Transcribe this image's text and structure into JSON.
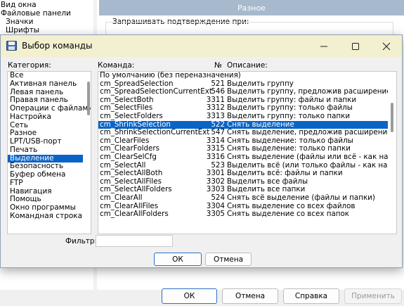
{
  "background": {
    "tree_items": [
      "Вид окна",
      "Файловые панели",
      "Значки",
      "Шрифты"
    ],
    "section_title": "Разное",
    "confirm_label": "Запрашивать подтверждение при:",
    "buttons": {
      "ok": "ОК",
      "cancel": "Отмена",
      "help": "Справка",
      "apply": "Применить"
    }
  },
  "dialog": {
    "title": "Выбор команды",
    "category_label": "Категория:",
    "command_label": "Команда:",
    "number_label": "№",
    "description_label": "Описание:",
    "filter_label": "Фильтр:",
    "filter_value": "",
    "ok": "ОК",
    "cancel": "Отмена",
    "categories": [
      "Все",
      "Активная панель",
      "Левая панель",
      "Правая панель",
      "Операции с файлами",
      "Настройка",
      "Сеть",
      "Разное",
      "LPT/USB-порт",
      "Печать",
      "Выделение",
      "Безопасность",
      "Буфер обмена",
      "FTP",
      "Навигация",
      "Помощь",
      "Окно программы",
      "Командная строка"
    ],
    "selected_category": "Выделение",
    "default_row": "По умолчанию (без переназначения)",
    "commands": [
      {
        "name": "cm_SpreadSelection",
        "num": "521",
        "desc": "Выделить группу"
      },
      {
        "name": "cm_SpreadSelectionCurrentExt",
        "num": "546",
        "desc": "Выделить группу, предложив расширение файла"
      },
      {
        "name": "cm_SelectBoth",
        "num": "3311",
        "desc": "Выделить группу: файлы и папки"
      },
      {
        "name": "cm_SelectFiles",
        "num": "3312",
        "desc": "Выделить группу: только файлы"
      },
      {
        "name": "cm_SelectFolders",
        "num": "3313",
        "desc": "Выделить группу: только папки"
      },
      {
        "name": "cm_ShrinkSelection",
        "num": "522",
        "desc": "Снять выделение"
      },
      {
        "name": "cm_ShrinkSelectionCurrentExt",
        "num": "547",
        "desc": "Снять выделение, предложив расширение файла"
      },
      {
        "name": "cm_ClearFiles",
        "num": "3314",
        "desc": "Снять выделение: только файлы"
      },
      {
        "name": "cm_ClearFolders",
        "num": "3315",
        "desc": "Снять выделение: только папки"
      },
      {
        "name": "cm_ClearSelCfg",
        "num": "3316",
        "desc": "Снять выделение (файлы или всё - как настроено)"
      },
      {
        "name": "cm_SelectAll",
        "num": "523",
        "desc": "Выделить всё (или только файлы - как настроено)"
      },
      {
        "name": "cm_SelectAllBoth",
        "num": "3301",
        "desc": "Выделить всё: файлы и папки"
      },
      {
        "name": "cm_SelectAllFiles",
        "num": "3302",
        "desc": "Выделить все файлы"
      },
      {
        "name": "cm_SelectAllFolders",
        "num": "3303",
        "desc": "Выделить все папки"
      },
      {
        "name": "cm_ClearAll",
        "num": "524",
        "desc": "Снять всё выделение (файлы и папки)"
      },
      {
        "name": "cm_ClearAllFiles",
        "num": "3304",
        "desc": "Снять выделение со всех файлов"
      },
      {
        "name": "cm_ClearAllFolders",
        "num": "3305",
        "desc": "Снять выделение со всех папок"
      }
    ],
    "selected_command": "cm_ShrinkSelection"
  }
}
